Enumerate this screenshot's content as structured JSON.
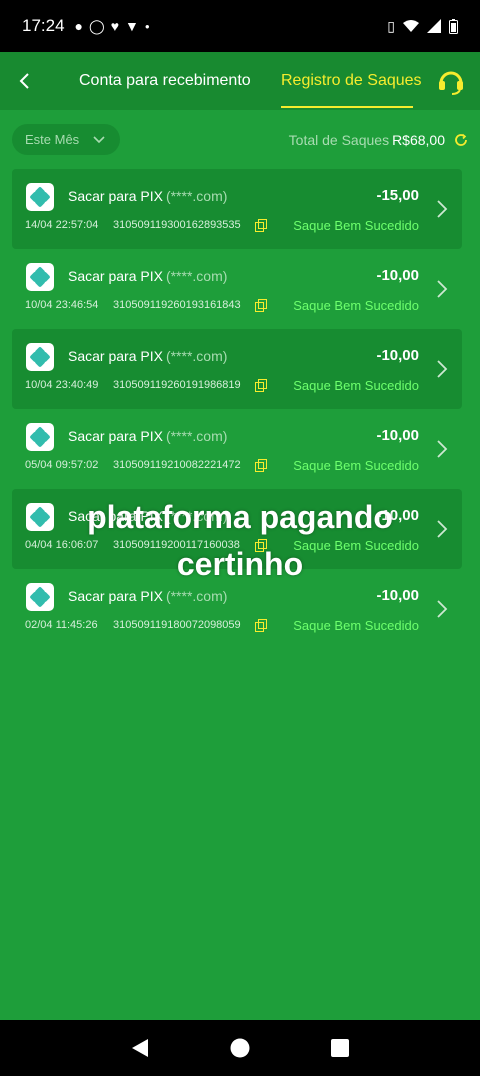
{
  "status_bar": {
    "time": "17:24",
    "icons": [
      "chat-icon",
      "whatsapp-icon",
      "heart-icon",
      "trophy-icon",
      "dot-icon"
    ],
    "right_icons": [
      "vibrate-icon",
      "wifi-icon",
      "signal-icon",
      "battery-icon"
    ]
  },
  "header": {
    "tab_account": "Conta para recebimento",
    "tab_history": "Registro de Saques",
    "active_tab": "Registro de Saques",
    "accent_color": "#f6ec2e"
  },
  "filter": {
    "month": "Este Mês",
    "total_label": "Total de Saques",
    "total_value": "R$68,00"
  },
  "withdrawals": [
    {
      "title": "Sacar para PIX",
      "email": "(****.com)",
      "amount": "-15,00",
      "date": "14/04 22:57:04",
      "id": "310509119300162893535",
      "status": "Saque Bem Sucedido",
      "shaded": true
    },
    {
      "title": "Sacar para PIX",
      "email": "(****.com)",
      "amount": "-10,00",
      "date": "10/04 23:46:54",
      "id": "310509119260193161843",
      "status": "Saque Bem Sucedido",
      "shaded": false
    },
    {
      "title": "Sacar para PIX",
      "email": "(****.com)",
      "amount": "-10,00",
      "date": "10/04 23:40:49",
      "id": "310509119260191986819",
      "status": "Saque Bem Sucedido",
      "shaded": true
    },
    {
      "title": "Sacar para PIX",
      "email": "(****.com)",
      "amount": "-10,00",
      "date": "05/04 09:57:02",
      "id": "310509119210082221472",
      "status": "Saque Bem Sucedido",
      "shaded": false
    },
    {
      "title": "Sacar para PIX",
      "email": "(****.com)",
      "amount": "-10,00",
      "date": "04/04 16:06:07",
      "id": "310509119200117160038",
      "status": "Saque Bem Sucedido",
      "shaded": true
    },
    {
      "title": "Sacar para PIX",
      "email": "(****.com)",
      "amount": "-10,00",
      "date": "02/04 11:45:26",
      "id": "310509119180072098059",
      "status": "Saque Bem Sucedido",
      "shaded": false
    }
  ],
  "overlay_caption": {
    "line1": "plataforma pagando",
    "line2": "certinho"
  },
  "colors": {
    "background": "#1e9e3a",
    "card": "#178c31",
    "success": "#6dff6d"
  }
}
